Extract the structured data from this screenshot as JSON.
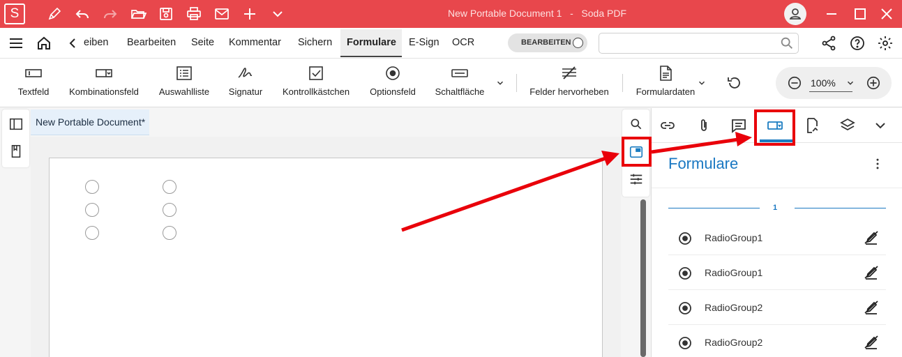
{
  "app": {
    "window_title": "New Portable Document 1",
    "title_separator": "-",
    "app_name": "Soda PDF",
    "logo_letter": "S"
  },
  "menu": {
    "items": [
      "eiben",
      "Bearbeiten",
      "Seite",
      "Kommentar",
      "Sichern",
      "Formulare",
      "E-Sign",
      "OCR"
    ],
    "active": "Formulare",
    "edit_toggle_label": "BEARBEITEN"
  },
  "search": {
    "placeholder": "",
    "value": ""
  },
  "ribbon": {
    "buttons": [
      "Textfeld",
      "Kombinationsfeld",
      "Auswahlliste",
      "Signatur",
      "Kontrollkästchen",
      "Optionsfeld",
      "Schaltfläche",
      "Felder hervorheben",
      "Formulardaten"
    ],
    "zoom": "100%"
  },
  "document": {
    "tab_title": "New Portable Document*"
  },
  "panel": {
    "title": "Formulare",
    "page_number": "1",
    "fields": [
      {
        "name": "RadioGroup1"
      },
      {
        "name": "RadioGroup1"
      },
      {
        "name": "RadioGroup2"
      },
      {
        "name": "RadioGroup2"
      }
    ]
  },
  "colors": {
    "titlebar": "#e8474c",
    "accent_blue": "#1a78c2",
    "annotation_red": "#e9000a"
  }
}
